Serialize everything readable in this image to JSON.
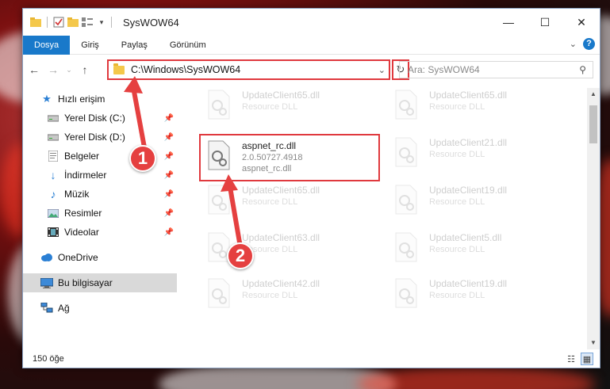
{
  "window": {
    "title": "SysWOW64",
    "controls": {
      "minimize": "—",
      "maximize": "☐",
      "close": "✕"
    }
  },
  "ribbon": {
    "tabs": [
      "Dosya",
      "Giriş",
      "Paylaş",
      "Görünüm"
    ]
  },
  "navigation": {
    "address": "C:\\Windows\\SysWOW64",
    "search_placeholder": "Ara: SysWOW64"
  },
  "sidebar": {
    "items": [
      {
        "label": "Hızlı erişim",
        "icon": "star-icon"
      },
      {
        "label": "Yerel Disk (C:)",
        "icon": "drive-icon",
        "pinned": true
      },
      {
        "label": "Yerel Disk (D:)",
        "icon": "drive-icon",
        "pinned": true
      },
      {
        "label": "Belgeler",
        "icon": "documents-icon",
        "pinned": true
      },
      {
        "label": "İndirmeler",
        "icon": "downloads-icon",
        "pinned": true
      },
      {
        "label": "Müzik",
        "icon": "music-icon",
        "pinned": true
      },
      {
        "label": "Resimler",
        "icon": "pictures-icon",
        "pinned": true
      },
      {
        "label": "Videolar",
        "icon": "videos-icon",
        "pinned": true
      },
      {
        "label": "OneDrive",
        "icon": "cloud-icon"
      },
      {
        "label": "Bu bilgisayar",
        "icon": "computer-icon",
        "selected": true
      },
      {
        "label": "Ağ",
        "icon": "network-icon"
      }
    ]
  },
  "files": {
    "left": [
      {
        "name": "UpdateClient65.dll",
        "desc": "Resource DLL"
      },
      {
        "name": "UpdateClient65.dll",
        "desc": "Resource DLL"
      },
      {
        "name": "UpdateClient63.dll",
        "desc": "Resource DLL"
      },
      {
        "name": "UpdateClient42.dll",
        "desc": "Resource DLL"
      }
    ],
    "right": [
      {
        "name": "UpdateClient65.dll",
        "desc": "Resource DLL"
      },
      {
        "name": "UpdateClient21.dll",
        "desc": "Resource DLL"
      },
      {
        "name": "UpdateClient19.dll",
        "desc": "Resource DLL"
      },
      {
        "name": "UpdateClient5.dll",
        "desc": "Resource DLL"
      },
      {
        "name": "UpdateClient19.dll",
        "desc": "Resource DLL"
      }
    ],
    "focus": {
      "name": "aspnet_rc.dll",
      "version": "2.0.50727.4918",
      "desc": "aspnet_rc.dll"
    }
  },
  "status": {
    "count": "150 öğe"
  },
  "callouts": {
    "one": "1",
    "two": "2"
  },
  "colors": {
    "accent": "#1979ca",
    "highlight": "#e0393e",
    "callout": "#e54040"
  }
}
